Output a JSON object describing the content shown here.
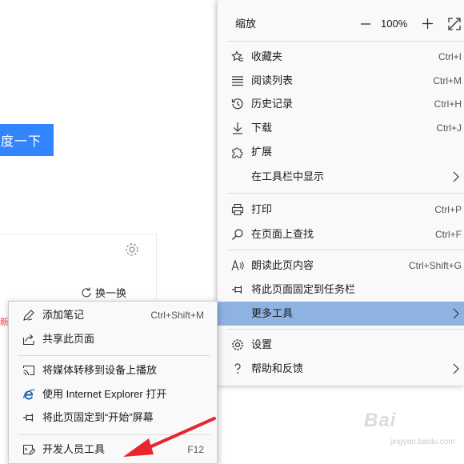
{
  "background": {
    "search_button": "度一下",
    "refresh_label": "换一换",
    "new_badge": "新"
  },
  "menu": {
    "zoom": {
      "label": "缩放",
      "value": "100%"
    },
    "items": [
      {
        "label": "收藏夹",
        "shortcut": "Ctrl+I",
        "icon": "favorites-icon"
      },
      {
        "label": "阅读列表",
        "shortcut": "Ctrl+M",
        "icon": "reading-list-icon"
      },
      {
        "label": "历史记录",
        "shortcut": "Ctrl+H",
        "icon": "history-icon"
      },
      {
        "label": "下载",
        "shortcut": "Ctrl+J",
        "icon": "download-icon"
      },
      {
        "label": "扩展",
        "shortcut": "",
        "icon": "extensions-icon"
      },
      {
        "label": "在工具栏中显示",
        "shortcut": "",
        "icon": ""
      },
      {
        "label": "打印",
        "shortcut": "Ctrl+P",
        "icon": "print-icon"
      },
      {
        "label": "在页面上查找",
        "shortcut": "Ctrl+F",
        "icon": "find-icon"
      },
      {
        "label": "朗读此页内容",
        "shortcut": "Ctrl+Shift+G",
        "icon": "read-aloud-icon"
      },
      {
        "label": "将此页面固定到任务栏",
        "shortcut": "",
        "icon": "pin-icon"
      },
      {
        "label": "更多工具",
        "shortcut": "",
        "icon": ""
      },
      {
        "label": "设置",
        "shortcut": "",
        "icon": "settings-icon"
      },
      {
        "label": "帮助和反馈",
        "shortcut": "",
        "icon": "help-icon"
      }
    ]
  },
  "submenu": {
    "items": [
      {
        "label": "添加笔记",
        "shortcut": "Ctrl+Shift+M"
      },
      {
        "label": "共享此页面",
        "shortcut": ""
      },
      {
        "label": "将媒体转移到设备上播放",
        "shortcut": ""
      },
      {
        "label": "使用 Internet Explorer 打开",
        "shortcut": ""
      },
      {
        "label": "将此页固定到“开始”屏幕",
        "shortcut": ""
      },
      {
        "label": "开发人员工具",
        "shortcut": "F12"
      }
    ]
  },
  "watermark": {
    "brand": "Bai",
    "sub": "jingyan.baidu.com"
  },
  "colors": {
    "highlight": "#8fb3e1",
    "search_blue": "#3385ff",
    "arrow_red": "#e8262b"
  }
}
